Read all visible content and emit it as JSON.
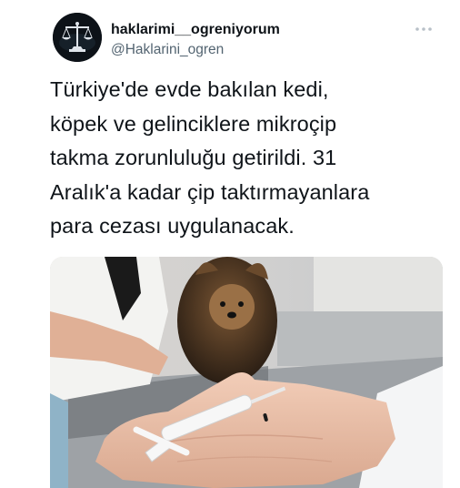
{
  "tweet": {
    "author": {
      "display_name": "haklarimi__ogreniyorum",
      "handle": "@Haklarini_ogren",
      "avatar_icon": "scales-of-justice-icon"
    },
    "more_icon": "more-dots-icon",
    "text": "Türkiye'de evde bakılan kedi,\nköpek ve gelinciklere mikroçip\ntakma zorunluluğu getirildi. 31\nAralık'a kadar çip taktırmayanlara\npara cezası uygulanacak.",
    "media_description": "photo-microchip-injector-in-palm-with-yorkshire-terrier",
    "colors": {
      "text": "#0f1419",
      "secondary": "#536471"
    }
  }
}
